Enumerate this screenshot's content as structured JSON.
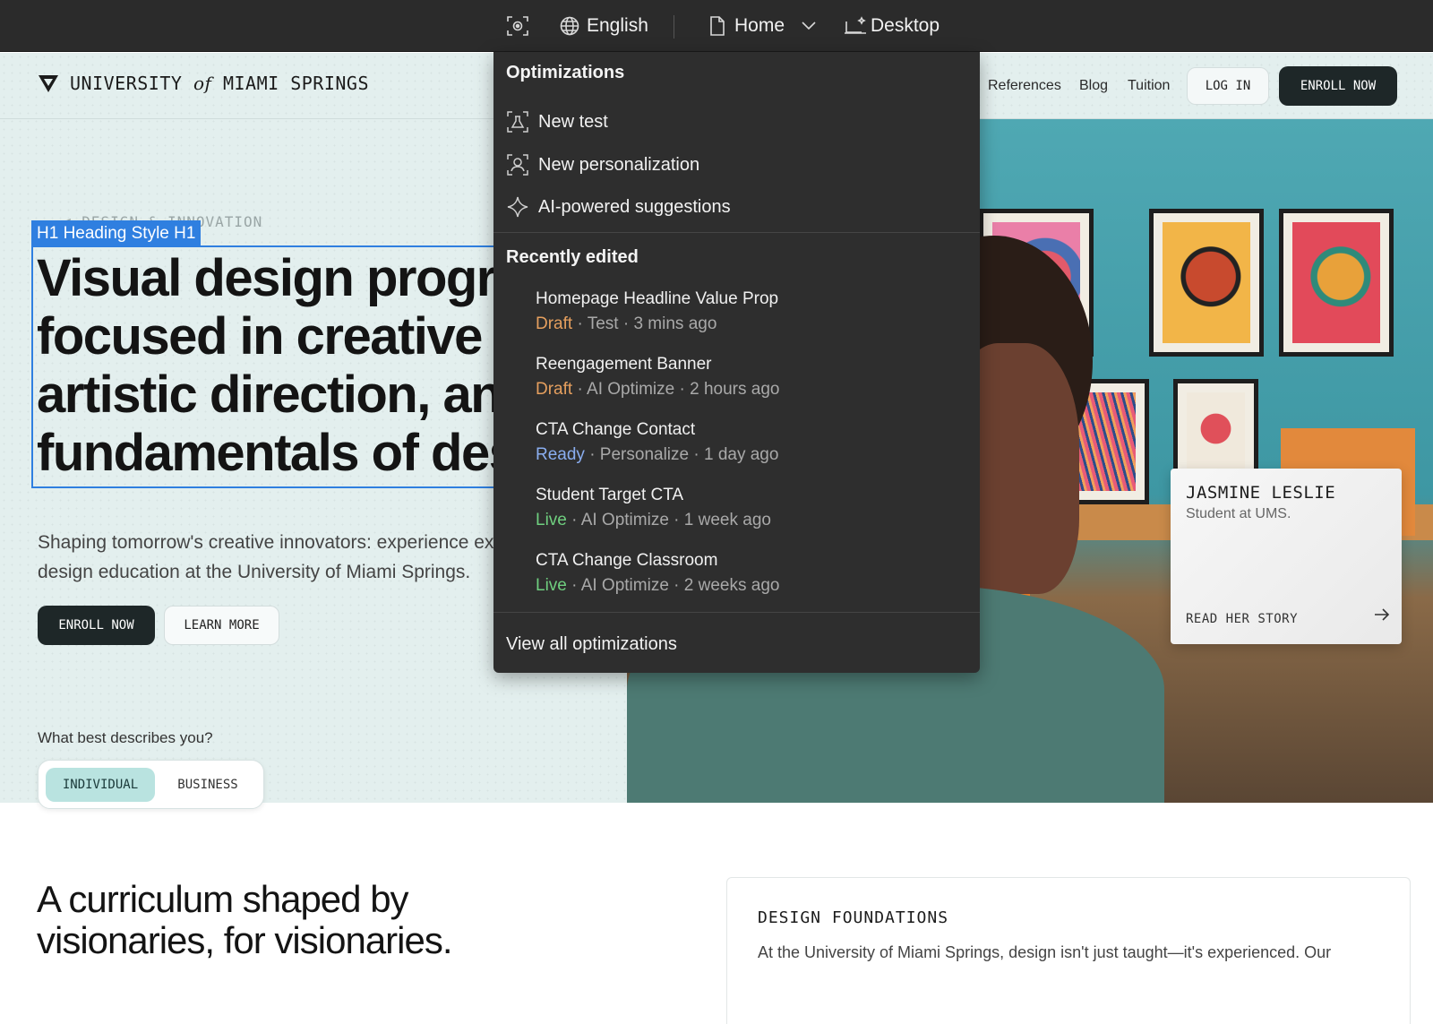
{
  "editor_bar": {
    "language": "English",
    "page": "Home",
    "device": "Desktop"
  },
  "site": {
    "logo": {
      "part1": "UNIVERSITY",
      "part2": "of",
      "part3": "MIAMI SPRINGS"
    },
    "nav": {
      "links": [
        "References",
        "Blog",
        "Tuition"
      ],
      "login": "LOG IN",
      "enroll": "ENROLL NOW"
    },
    "hero": {
      "eyebrow": "< DESIGN & INNOVATION",
      "selection_tag": "H1  Heading Style H1",
      "headline": "Visual design programs focused in creative arts, artistic direction, and fundamentals of design",
      "subcopy_line1": "Shaping tomorrow's creative innovators: experience exceptional",
      "subcopy_line2": "design education at the University of Miami Springs.",
      "enroll": "ENROLL NOW",
      "learn_more": "LEARN MORE",
      "describe_label": "What best describes you?",
      "toggle": {
        "individual": "INDIVIDUAL",
        "business": "BUSINESS",
        "selected": "INDIVIDUAL"
      }
    },
    "story_card": {
      "name": "JASMINE LESLIE",
      "role": "Student at UMS.",
      "link": "READ HER STORY"
    },
    "curriculum": {
      "line1": "A curriculum shaped by",
      "line2": "visionaries, for visionaries."
    },
    "foundations": {
      "title": "DESIGN FOUNDATIONS",
      "copy": "At the University of Miami Springs, design isn't just taught—it's experienced. Our"
    }
  },
  "dropdown": {
    "optimizations_header": "Optimizations",
    "actions": [
      {
        "label": "New test",
        "icon": "flask-icon"
      },
      {
        "label": "New personalization",
        "icon": "person-scan-icon"
      },
      {
        "label": "AI-powered suggestions",
        "icon": "sparkle-icon"
      }
    ],
    "recent_header": "Recently edited",
    "recent": [
      {
        "title": "Homepage Headline Value Prop",
        "status": "Draft",
        "meta": " · Test · 3 mins ago"
      },
      {
        "title": "Reengagement Banner",
        "status": "Draft",
        "meta": " · AI Optimize · 2 hours ago"
      },
      {
        "title": "CTA Change Contact",
        "status": "Ready",
        "meta": " · Personalize · 1 day ago"
      },
      {
        "title": "Student Target CTA",
        "status": "Live",
        "meta": " ·  AI Optimize · 1 week ago"
      },
      {
        "title": "CTA Change Classroom",
        "status": "Live",
        "meta": " · AI Optimize · 2 weeks ago"
      }
    ],
    "footer": "View all optimizations"
  },
  "colors": {
    "accent_selection": "#2f7fe0",
    "draft": "#e59f5e",
    "ready": "#8aaef0",
    "live": "#6fcf7f"
  }
}
